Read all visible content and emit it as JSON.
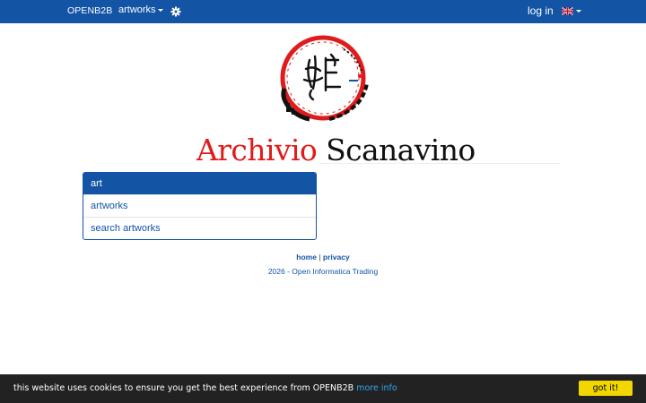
{
  "navbar": {
    "brand": "OPENB2B",
    "artworks_label": "artworks",
    "gear_icon": "gear-icon",
    "login_label": "log in",
    "language_icon": "uk-flag-icon"
  },
  "logo": {
    "description_icon": "archivio-scanavino-logo"
  },
  "title": {
    "part1": "Archivio",
    "part2": "Scanavino"
  },
  "menu": {
    "items": [
      {
        "label": "art",
        "active": true
      },
      {
        "label": "artworks",
        "active": false
      },
      {
        "label": "search artworks",
        "active": false
      }
    ]
  },
  "footer": {
    "home_label": "home",
    "separator": " | ",
    "privacy_label": "privacy",
    "copyright": "2026 - Open Informatica Trading"
  },
  "cookie_bar": {
    "message": "this website uses cookies to ensure you get the best experience from OPENB2B",
    "more_info_label": "more info",
    "button_label": "got it!"
  },
  "colors": {
    "primary": "#1354a5",
    "title_red": "#e01b1b",
    "cookie_bg": "#222222",
    "cookie_button": "#f1d600",
    "cookie_link": "#31a8f0"
  }
}
